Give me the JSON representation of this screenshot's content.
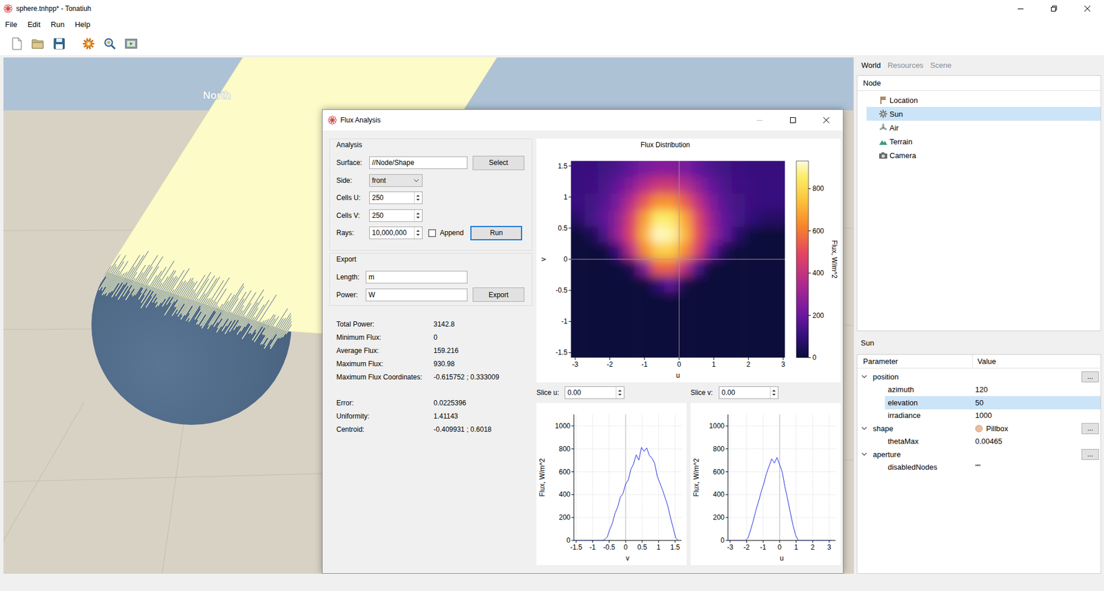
{
  "window": {
    "title": "sphere.tnhpp* - Tonatiuh"
  },
  "menu": [
    "File",
    "Edit",
    "Run",
    "Help"
  ],
  "toolbar": [
    [
      {
        "kind": "new"
      },
      {
        "kind": "open"
      },
      {
        "kind": "save"
      }
    ],
    [
      {
        "kind": "run"
      },
      {
        "kind": "flux"
      },
      {
        "kind": "animate"
      }
    ]
  ],
  "scene": {
    "compass_label": "North"
  },
  "dialog": {
    "title": "Flux Analysis",
    "minimize_enabled": false,
    "analysis": {
      "title": "Analysis",
      "surface": {
        "label": "Surface:",
        "value": "//Node/Shape",
        "button": "Select"
      },
      "side": {
        "label": "Side:",
        "value": "front"
      },
      "cells_u": {
        "label": "Cells U:",
        "value": "250"
      },
      "cells_v": {
        "label": "Cells V:",
        "value": "250"
      },
      "rays": {
        "label": "Rays:",
        "value": "10,000,000"
      },
      "append": {
        "label": "Append",
        "checked": false
      },
      "run": {
        "label": "Run",
        "focused": true
      }
    },
    "export": {
      "title": "Export",
      "length": {
        "label": "Length:",
        "value": "m"
      },
      "power": {
        "label": "Power:",
        "value": "W"
      },
      "button": "Export"
    },
    "results": [
      [
        {
          "label": "Total Power:",
          "value": "3142.8"
        },
        {
          "label": "Minimum Flux:",
          "value": "0"
        },
        {
          "label": "Average Flux:",
          "value": "159.216"
        },
        {
          "label": "Maximum Flux:",
          "value": "930.98"
        },
        {
          "label": "Maximum Flux Coordinates:",
          "value": "-0.615752 ; 0.333009"
        }
      ],
      [
        {
          "label": "Error:",
          "value": "0.0225396"
        },
        {
          "label": "Uniformity:",
          "value": "1.41143"
        },
        {
          "label": "Centroid:",
          "value": "-0.409931 ; 0.6018"
        }
      ]
    ],
    "flux_chart": {
      "title": "Flux Distribution",
      "x_label": "u",
      "y_label": "v",
      "colorbar_label": "Flux, W/m^2",
      "x_ticks": [
        "-3",
        "-2",
        "-1",
        "0",
        "1",
        "2",
        "3"
      ],
      "y_ticks": [
        "1.5",
        "1",
        "0.5",
        "0",
        "-0.5",
        "-1",
        "-1.5"
      ],
      "colorbar_ticks": [
        "0",
        "200",
        "400",
        "600",
        "800"
      ],
      "u_range": [
        -3.12,
        3.05
      ],
      "v_range": [
        -1.58,
        1.58
      ],
      "flux_max": 931,
      "grid": [
        [
          111,
          114,
          124,
          145,
          181,
          226,
          257,
          258,
          229,
          186,
          148,
          125,
          115,
          111,
          110,
          110
        ],
        [
          111,
          119,
          140,
          185,
          264,
          359,
          428,
          430,
          366,
          274,
          192,
          143,
          120,
          112,
          110,
          110
        ],
        [
          114,
          125,
          161,
          237,
          369,
          530,
          645,
          648,
          541,
          386,
          248,
          165,
          127,
          114,
          110,
          110
        ],
        [
          69,
          131,
          178,
          281,
          460,
          675,
          860,
          850,
          690,
          482,
          296,
          184,
          133,
          100,
          67,
          66
        ],
        [
          0,
          34,
          130,
          292,
          482,
          712,
          920,
          900,
          728,
          506,
          308,
          183,
          73,
          10,
          0,
          0
        ],
        [
          0,
          0,
          0,
          106,
          370,
          627,
          770,
          773,
          640,
          450,
          185,
          41,
          0,
          0,
          0,
          0
        ],
        [
          0,
          0,
          0,
          0,
          36,
          247,
          552,
          555,
          373,
          125,
          0,
          0,
          0,
          0,
          0,
          0
        ],
        [
          0,
          0,
          0,
          0,
          0,
          0,
          91,
          180,
          18,
          0,
          0,
          0,
          0,
          0,
          0,
          0
        ],
        [
          0,
          0,
          0,
          0,
          0,
          0,
          0,
          0,
          0,
          0,
          0,
          0,
          0,
          0,
          0,
          0
        ],
        [
          0,
          0,
          0,
          0,
          0,
          0,
          0,
          0,
          0,
          0,
          0,
          0,
          0,
          0,
          0,
          0
        ],
        [
          0,
          0,
          0,
          0,
          0,
          0,
          0,
          0,
          0,
          0,
          0,
          0,
          0,
          0,
          0,
          0
        ],
        [
          0,
          0,
          0,
          0,
          0,
          0,
          0,
          0,
          0,
          0,
          0,
          0,
          0,
          0,
          0,
          0
        ]
      ]
    },
    "slice_u": {
      "label": "Slice u:",
      "value": "0.00"
    },
    "slice_v": {
      "label": "Slice v:",
      "value": "0.00"
    },
    "slice_charts": [
      {
        "x_label": "v",
        "y_label": "Flux, W/m^2",
        "x_ticks": [
          "-1.5",
          "-1",
          "-0.5",
          "0",
          "0.5",
          "1",
          "1.5"
        ],
        "y_ticks": [
          "0",
          "200",
          "400",
          "600",
          "800",
          "1000"
        ],
        "x_range": [
          -1.57,
          1.69
        ],
        "y_range": [
          0,
          1100
        ],
        "series": {
          "from": -1.6,
          "to": 1.6,
          "values": [
            0,
            0,
            0,
            0,
            0,
            0,
            0,
            0,
            0,
            0,
            0,
            0,
            6,
            28,
            96,
            152,
            238,
            292,
            378,
            410,
            492,
            528,
            622,
            668,
            748,
            702,
            812,
            778,
            808,
            742,
            718,
            672,
            560,
            500,
            440,
            370,
            300,
            200,
            110,
            20,
            0
          ]
        }
      },
      {
        "x_label": "u",
        "y_label": "Flux, W/m^2",
        "x_ticks": [
          "-3",
          "-2",
          "-1",
          "0",
          "1",
          "2",
          "3"
        ],
        "y_ticks": [
          "0",
          "200",
          "400",
          "600",
          "800",
          "1000"
        ],
        "x_range": [
          -3.13,
          3.38
        ],
        "y_range": [
          0,
          1100
        ],
        "series": {
          "from": -3.2,
          "to": 3.2,
          "values": [
            0,
            0,
            0,
            0,
            0,
            0,
            0,
            0,
            20,
            90,
            170,
            262,
            338,
            424,
            496,
            584,
            648,
            712,
            676,
            724,
            662,
            596,
            468,
            362,
            248,
            138,
            48,
            0,
            0,
            0,
            0,
            0,
            0,
            0,
            0,
            0,
            0,
            0,
            0,
            0,
            0
          ]
        }
      }
    ]
  },
  "dock": {
    "tabs": [
      {
        "label": "World",
        "selected": true
      },
      {
        "label": "Resources",
        "selected": false
      },
      {
        "label": "Scene",
        "selected": false
      }
    ],
    "tree": {
      "header": "Node",
      "items": [
        {
          "label": "Location",
          "kind": "location",
          "selected": false
        },
        {
          "label": "Sun",
          "kind": "sun",
          "selected": true
        },
        {
          "label": "Air",
          "kind": "air",
          "selected": false
        },
        {
          "label": "Terrain",
          "kind": "terrain",
          "selected": false
        },
        {
          "label": "Camera",
          "kind": "camera",
          "selected": false
        }
      ]
    },
    "properties": {
      "title": "Sun",
      "columns": [
        "Parameter",
        "Value"
      ],
      "rows": [
        {
          "name": "position",
          "value": "",
          "kind": "group",
          "expanded": true,
          "button": "...",
          "selected": false
        },
        {
          "name": "azimuth",
          "value": "120",
          "kind": "field",
          "selected": false
        },
        {
          "name": "elevation",
          "value": "50",
          "kind": "field",
          "selected": true
        },
        {
          "name": "irradiance",
          "value": "1000",
          "kind": "field",
          "selected": false
        },
        {
          "name": "shape",
          "value": "Pillbox",
          "kind": "choice",
          "expanded": true,
          "button": "...",
          "selected": false
        },
        {
          "name": "thetaMax",
          "value": "0.00465",
          "kind": "field",
          "selected": false
        },
        {
          "name": "aperture",
          "value": "",
          "kind": "group",
          "expanded": true,
          "button": "...",
          "selected": false
        },
        {
          "name": "disabledNodes",
          "value": "\"\"",
          "kind": "field",
          "selected": false
        }
      ]
    }
  }
}
